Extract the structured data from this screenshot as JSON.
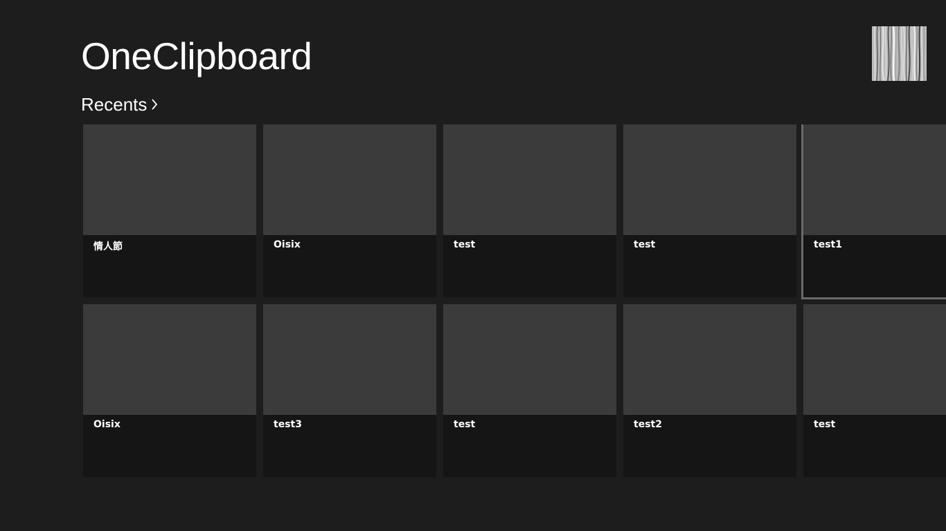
{
  "app": {
    "title": "OneClipboard"
  },
  "account": {
    "avatar_icon": "user-avatar-image"
  },
  "section": {
    "title": "Recents",
    "chevron_icon": "chevron-right-icon"
  },
  "items": [
    {
      "label": "情人節",
      "selected": false
    },
    {
      "label": "Oisix",
      "selected": false
    },
    {
      "label": "test",
      "selected": false
    },
    {
      "label": "test",
      "selected": false
    },
    {
      "label": "test1",
      "selected": true
    },
    {
      "label": "Oisix",
      "selected": false
    },
    {
      "label": "test3",
      "selected": false
    },
    {
      "label": "test",
      "selected": false
    },
    {
      "label": "test2",
      "selected": false
    },
    {
      "label": "test",
      "selected": false
    }
  ],
  "colors": {
    "background": "#1d1d1d",
    "tile_body": "#151515",
    "tile_thumb": "#3b3b3b",
    "selection_border": "#6a6a6a"
  }
}
